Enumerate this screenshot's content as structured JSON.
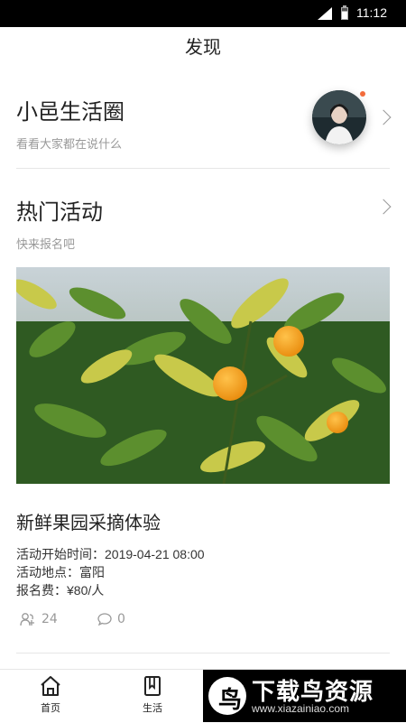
{
  "status_bar": {
    "time": "11:12"
  },
  "header": {
    "title": "发现"
  },
  "circle": {
    "title": "小邑生活圈",
    "subtitle": "看看大家都在说什么"
  },
  "hot": {
    "title": "热门活动",
    "subtitle": "快来报名吧"
  },
  "activity": {
    "title": "新鲜果园采摘体验",
    "start_time": "活动开始时间：2019-04-21 08:00",
    "location": "活动地点：富阳",
    "fee": "报名费：¥80/人",
    "participants": "24",
    "comments": "0"
  },
  "tabbar": {
    "items": [
      {
        "label": "首页",
        "icon": "home-icon"
      },
      {
        "label": "生活",
        "icon": "bookmark-icon"
      }
    ]
  },
  "watermark": {
    "logo_char": "鸟",
    "text": "下载鸟资源",
    "url": "www.xiazainiao.com"
  },
  "colors": {
    "notification_dot": "#f26b3a",
    "divider": "#e6e6e6",
    "muted_text": "#999999"
  }
}
